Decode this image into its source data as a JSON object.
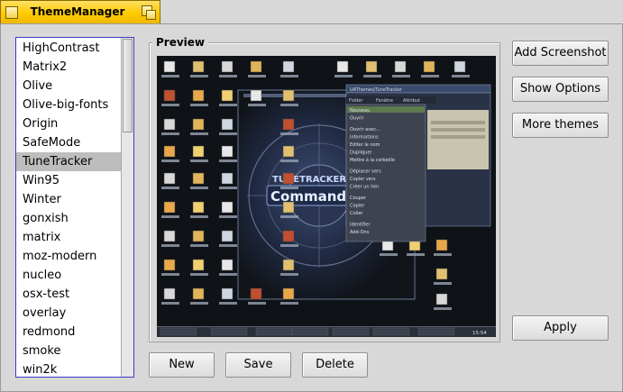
{
  "window": {
    "title": "ThemeManager"
  },
  "themes": {
    "items": [
      "HighContrast",
      "Matrix2",
      "Olive",
      "Olive-big-fonts",
      "Origin",
      "SafeMode",
      "TuneTracker",
      "Win95",
      "Winter",
      "gonxish",
      "matrix",
      "moz-modern",
      "nucleo",
      "osx-test",
      "overlay",
      "redmond",
      "smoke",
      "win2k"
    ],
    "selected": "TuneTracker"
  },
  "preview": {
    "label": "Preview",
    "screenshot": {
      "title_line1": "TUNETRACKER",
      "title_line2": "Command C",
      "menu_tabs": [
        "Folder",
        "Fenêtre",
        "Attribut"
      ],
      "menu_items": [
        "Nouveau",
        "Ouvrir",
        "Ouvrir avec...",
        "Informations",
        "Editer le nom",
        "Dupliquer",
        "Mettre à la corbeille",
        "Déplacer vers",
        "Copier vers",
        "Créer un lien",
        "Couper",
        "Copier",
        "Coller",
        "Identifier",
        "Add-Ons"
      ],
      "file_window_title": "UAThemes/TuneTracker",
      "taskbar_clock": "15:54"
    }
  },
  "buttons": {
    "add_screenshot": "Add Screenshot",
    "show_options": "Show Options",
    "more_themes": "More themes",
    "apply": "Apply",
    "new": "New",
    "save": "Save",
    "delete": "Delete"
  }
}
